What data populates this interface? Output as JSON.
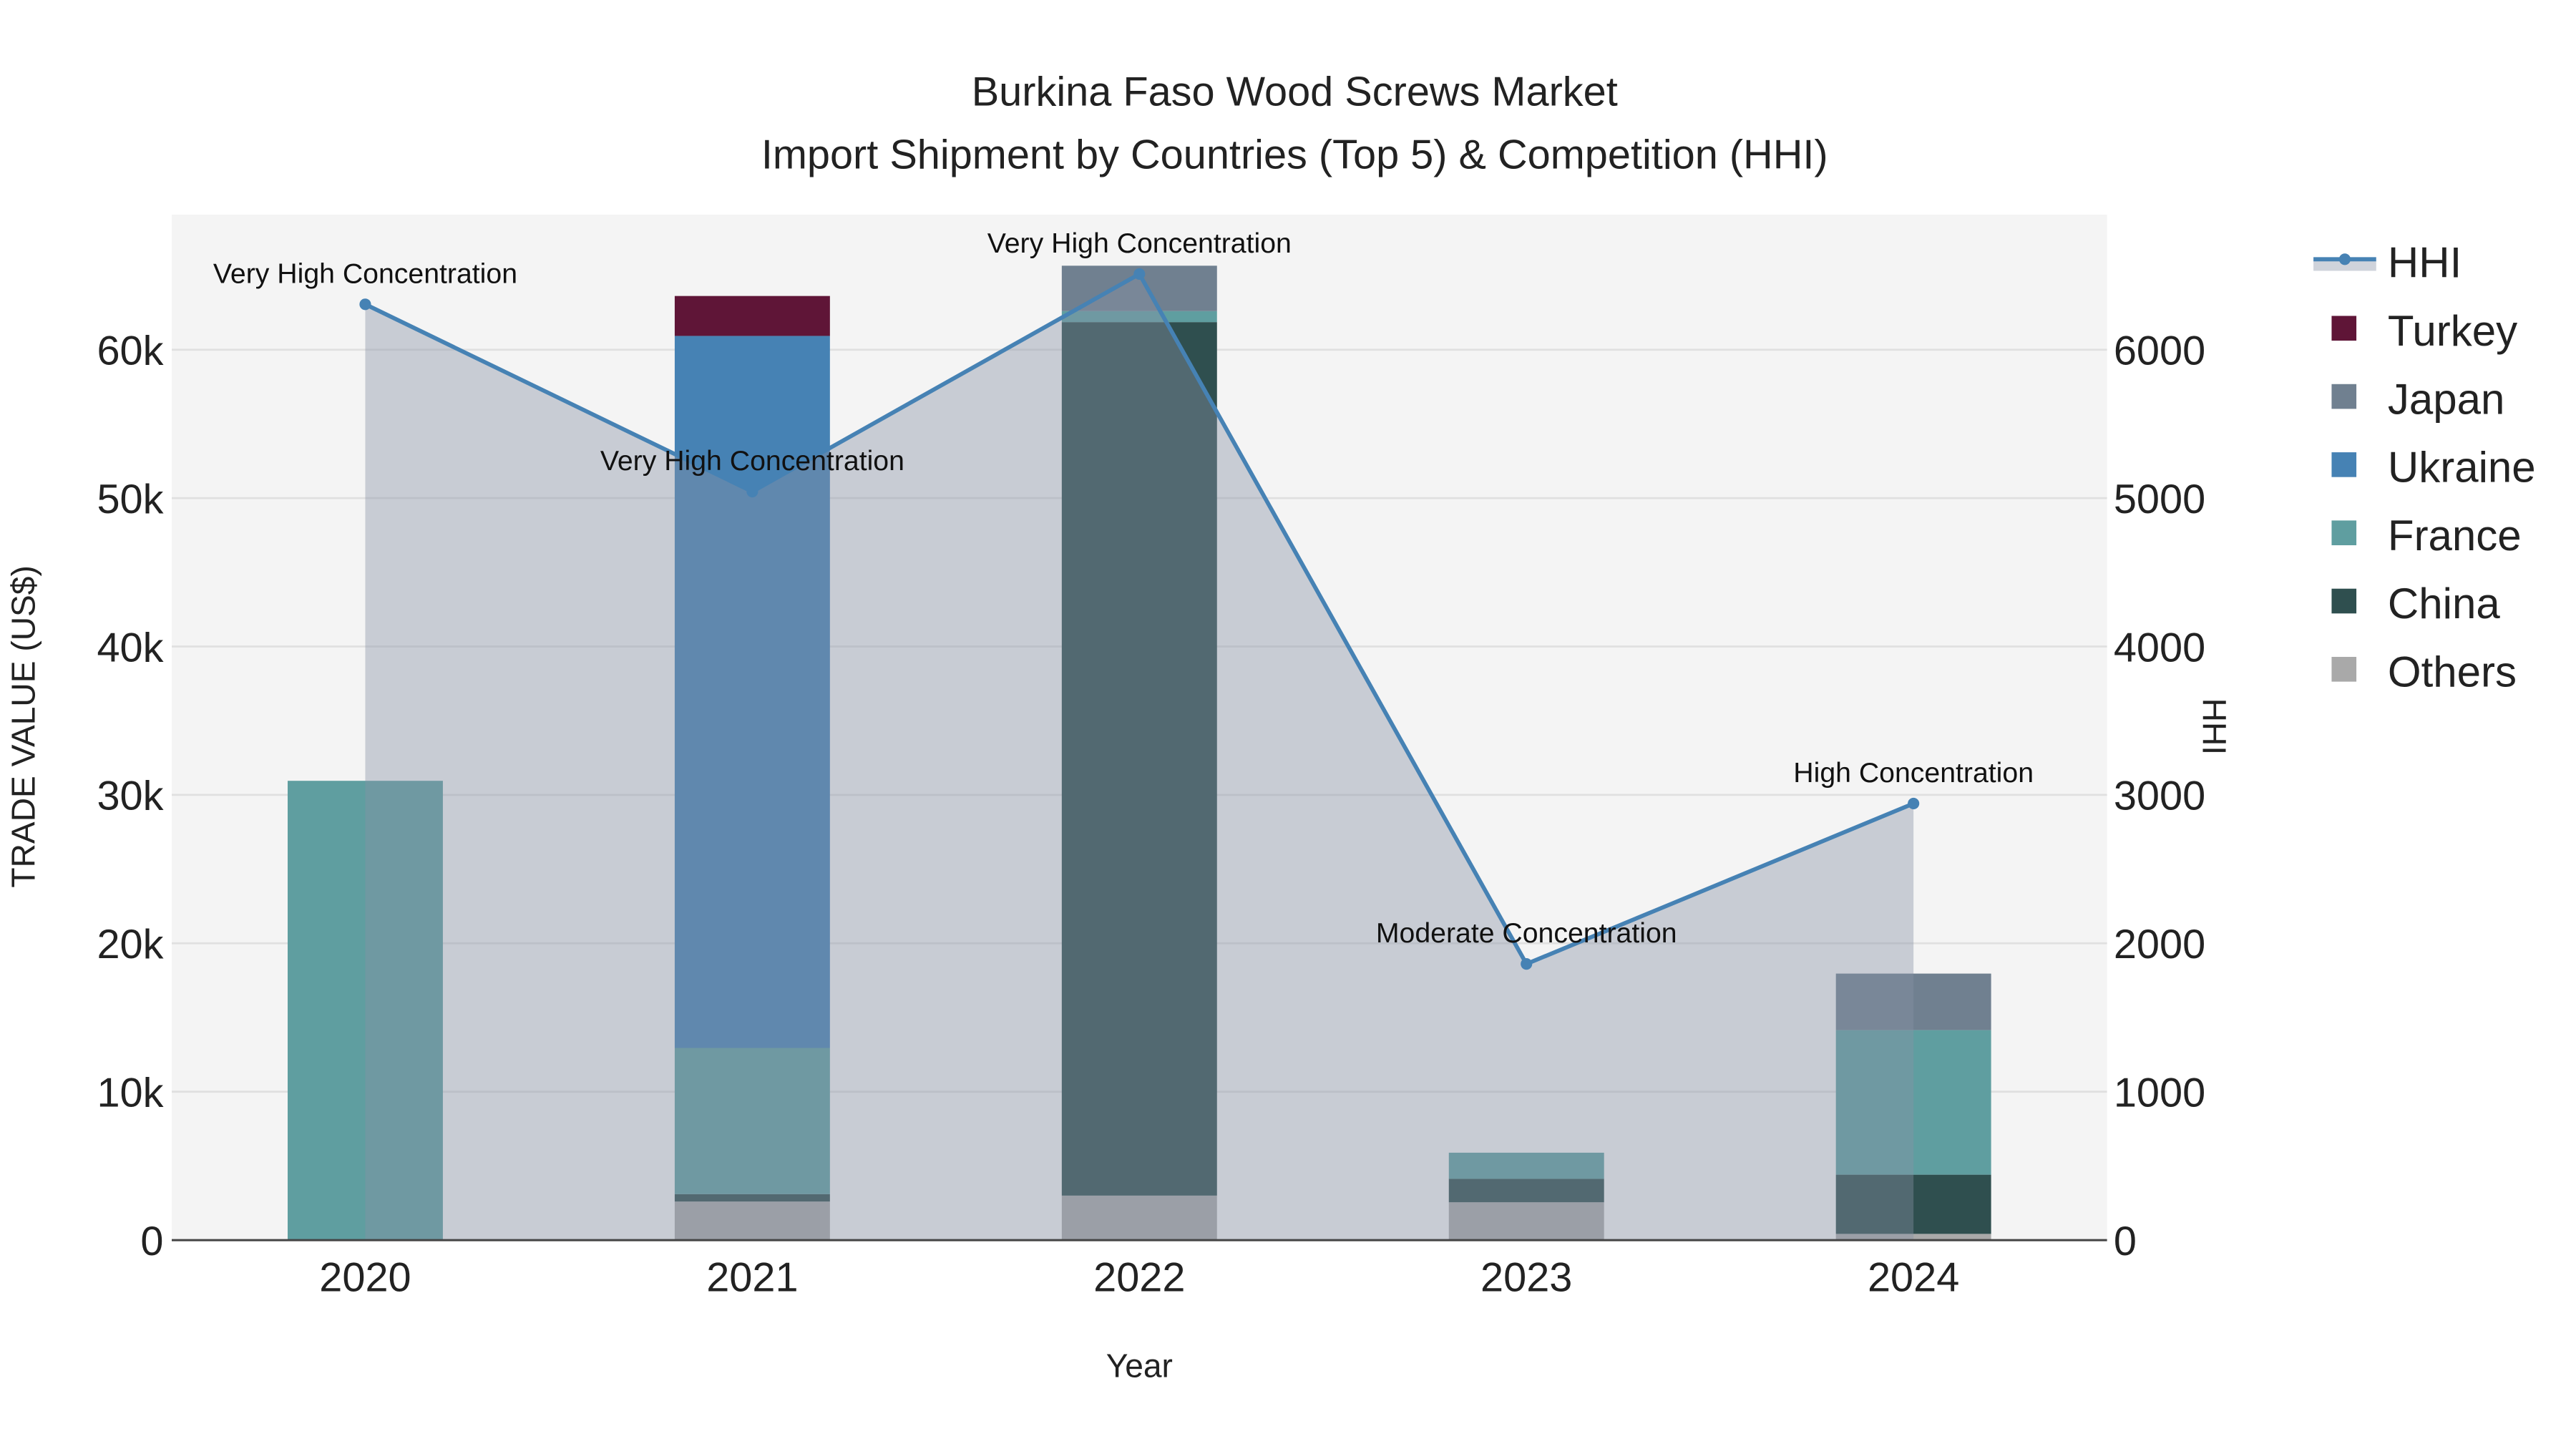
{
  "chart_data": {
    "type": "bar",
    "title": "Burkina Faso Wood Screws Market",
    "subtitle": "Import Shipment by Countries (Top 5) & Competition (HHI)",
    "xlabel": "Year",
    "ylabel": "TRADE VALUE (US$)",
    "y2label": "HHI",
    "categories": [
      "2020",
      "2021",
      "2022",
      "2023",
      "2024"
    ],
    "ylim": [
      0,
      69100
    ],
    "y2lim": [
      0,
      6910
    ],
    "yticks": [
      0,
      10000,
      20000,
      30000,
      40000,
      50000,
      60000
    ],
    "ytick_labels": [
      "0",
      "10k",
      "20k",
      "30k",
      "40k",
      "50k",
      "60k"
    ],
    "y2ticks": [
      0,
      1000,
      2000,
      3000,
      4000,
      5000,
      6000
    ],
    "y2tick_labels": [
      "0",
      "1000",
      "2000",
      "3000",
      "4000",
      "5000",
      "6000"
    ],
    "stacked": true,
    "series": [
      {
        "name": "Others",
        "color": "#a9a9a9",
        "values": [
          0,
          2600,
          3000,
          2550,
          420
        ]
      },
      {
        "name": "China",
        "color": "#2f4f4f",
        "values": [
          0,
          500,
          58860,
          1580,
          3990
        ]
      },
      {
        "name": "France",
        "color": "#5f9ea0",
        "values": [
          30950,
          9850,
          740,
          1760,
          9740
        ]
      },
      {
        "name": "Ukraine",
        "color": "#4682b4",
        "values": [
          0,
          47980,
          0,
          0,
          0
        ]
      },
      {
        "name": "Japan",
        "color": "#708090",
        "values": [
          0,
          0,
          3060,
          0,
          3810
        ]
      },
      {
        "name": "Turkey",
        "color": "#5f1537",
        "values": [
          0,
          2690,
          0,
          0,
          0
        ]
      }
    ],
    "line": {
      "name": "HHI",
      "axis": "right",
      "color": "#4682b4",
      "values": [
        6306,
        5044,
        6510,
        1861,
        2942
      ],
      "annotations": [
        "Very High Concentration",
        "Very High Concentration",
        "Very High Concentration",
        "Moderate Concentration",
        "High Concentration"
      ]
    },
    "legend": {
      "position": "right",
      "entries": [
        "HHI",
        "Turkey",
        "Japan",
        "Ukraine",
        "France",
        "China",
        "Others"
      ]
    },
    "grid": true
  }
}
